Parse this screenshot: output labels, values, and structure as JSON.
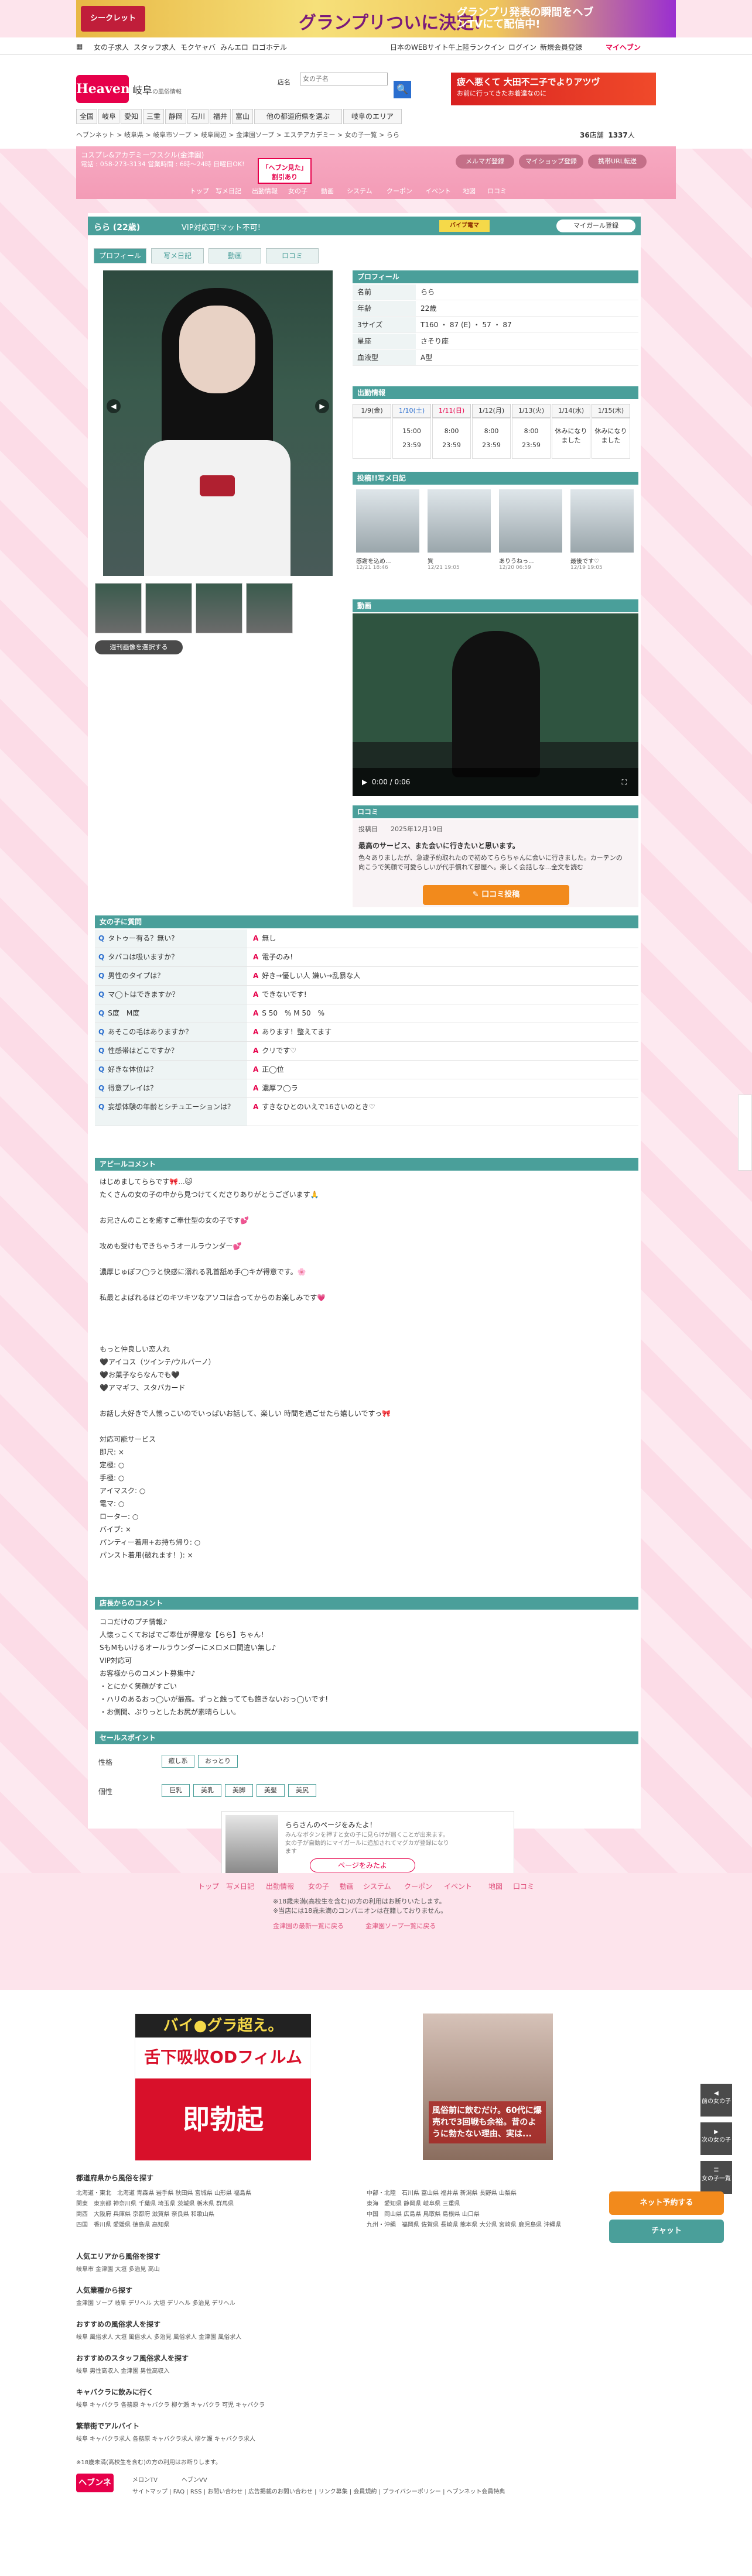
{
  "top_banner": {
    "logo": "シークレット",
    "headline": "グランプリついに決定!",
    "sub": "グランプリ発表の瞬間をヘブンTVにて配信中!"
  },
  "gnav": [
    "女の子求人",
    "スタッフ求人",
    "モクヤャバ",
    "みんエロ",
    "ロゴホテル"
  ],
  "gnav_right": [
    "日本のWEBサイト午上陸ランクイン",
    "ログイン",
    "新規会員登録",
    "マイヘブン"
  ],
  "logo": {
    "text": "Heaven",
    "area": "岐阜",
    "sub": "の風俗情報"
  },
  "search": {
    "label": "店名",
    "placeholder": "女の子名",
    "button": "🔍"
  },
  "header_banner": {
    "text": "疲へ悪くて 大田不二子でよりアツヴ",
    "sub": "お前に行ってきたお着達なのに"
  },
  "area_nav": [
    "全国",
    "岐阜",
    "愛知",
    "三重",
    "静岡",
    "石川",
    "福井",
    "富山",
    "他の都道府県を選ぶ",
    "岐阜のエリア"
  ],
  "breadcrumb": "ヘブンネット > 岐阜県 > 岐阜市ソープ > 岐阜周辺 > 金津園ソープ > エステアカデミー > 女の子一覧 > らら",
  "counts": {
    "shops": "36",
    "shops_unit": "店舗",
    "girls": "1337",
    "girls_unit": "人"
  },
  "shop": {
    "name": "コスプレ&アカデミーワスクル(金津園)",
    "tel": "電話 : 058-273-3134 営業時間 : 6時〜24時 日曜日OK!",
    "tag": "「ヘブン見た」",
    "tag2": "割引あり",
    "buttons": [
      "メルマガ登録",
      "マイショップ登録",
      "携帯URL転送"
    ]
  },
  "shop_nav": [
    "トップ",
    "写メ日記",
    "出勤情報",
    "女の子",
    "動画",
    "システム",
    "クーポン",
    "イベント",
    "地図",
    "ロコミ"
  ],
  "girl": {
    "name": "らら (22歳)",
    "vip": "VIP対応可!マット不可!",
    "icons_label": "バイブ電マ",
    "fav": "マイガール登録"
  },
  "tabs": [
    "プロフィール",
    "写メ日記",
    "動画",
    "ロコミ"
  ],
  "detail_button": "週刊画像を選択する",
  "profile": {
    "title": "プロフィール",
    "rows": [
      {
        "k": "名前",
        "v": "らら"
      },
      {
        "k": "年齢",
        "v": "22歳"
      },
      {
        "k": "3サイズ",
        "v": "T160 ・ 87 (E) ・ 57 ・ 87"
      },
      {
        "k": "星座",
        "v": "さそり座"
      },
      {
        "k": "血液型",
        "v": "A型"
      }
    ]
  },
  "schedule": {
    "title": "出勤情報",
    "days": [
      {
        "d": "1/9(金)",
        "t": ""
      },
      {
        "d": "1/10(土)",
        "t": "15:00\n23:59"
      },
      {
        "d": "1/11(日)",
        "t": "8:00\n23:59"
      },
      {
        "d": "1/12(月)",
        "t": "8:00\n23:59"
      },
      {
        "d": "1/13(火)",
        "t": "8:00\n23:59"
      },
      {
        "d": "1/14(水)",
        "t": "休みになりました"
      },
      {
        "d": "1/15(木)",
        "t": "休みになりました"
      }
    ]
  },
  "diary": {
    "title": "投稿!!写メ日記",
    "items": [
      {
        "t": "感謝を込め...",
        "d": "12/21 18:46"
      },
      {
        "t": "質",
        "d": "12/21 19:05"
      },
      {
        "t": "ありうねっ...",
        "d": "12/20 06:59"
      },
      {
        "t": "最後です♡",
        "d": "12/19 19:05"
      }
    ]
  },
  "video": {
    "title": "動画",
    "time": "0:00 / 0:06"
  },
  "review": {
    "title": "ロコミ",
    "date": "投稿日　　2025年12月19日",
    "headline": "最高のサービス、また会いに行きたいと思います。",
    "body": "色々ありましたが、急遽予約取れたので初めてららちゃんに会いに行きました。カーテンの向こうで笑顔で可愛らしいが代手慣れて部屋へ。楽しく会話しな...全文を読む",
    "button": "✎ 口コミ投稿"
  },
  "qa": {
    "title": "女の子に質問",
    "rows": [
      {
        "q": "タトゥー有る？無い?",
        "a": "無し"
      },
      {
        "q": "タバコは吸いますか？",
        "a": "電子のみ!"
      },
      {
        "q": "男性のタイプは？",
        "a": "好き→優しい人 嫌い→乱暴な人"
      },
      {
        "q": "マ◯トはできますか？",
        "a": "できないです!"
      },
      {
        "q": "S度　M度",
        "a": "S 50　% M 50　%"
      },
      {
        "q": "あそこの毛はありますか？",
        "a": "あります！整えてます"
      },
      {
        "q": "性感帯はどこですか？",
        "a": "クリです♡"
      },
      {
        "q": "好きな体位は？",
        "a": "正◯位"
      },
      {
        "q": "得意プレイは？",
        "a": "濃厚フ◯ラ"
      },
      {
        "q": "妄想体験の年齢とシチュエーションは？",
        "a": "すきなひとのいえで16さいのとき♡"
      }
    ]
  },
  "appeal": {
    "title": "アピールコメント",
    "lines": [
      "はじめましてららです🎀...🐱",
      "たくさんの女の子の中から見つけてくださりありがとうございます🙏",
      "",
      "お兄さんのことを癒すご奉仕型の女の子です💕",
      "",
      "攻めも受けもできちゃうオールラウンダー💕",
      "",
      "濃厚じゅぽフ◯ラと快感に溺れる乳首舐め手◯キが得意です。🌸",
      "",
      "私最とよばれるほどのキツキツなアソコは合ってからのお楽しみです💗",
      "",
      "",
      "",
      "もっと仲良しい恋人れ",
      "🖤アイコス（ツインテ/ウルバーノ）",
      "🖤お菓子ならなんでも🖤",
      "🖤アマギフ、スタバカード",
      "",
      "お話し大好きで人懐っこいのでいっぱいお話して、楽しい 時間を過ごせたら嬉しいですっ🎀",
      "",
      "対応可能サービス",
      "即尺: ×",
      "定極: ○",
      "手極: ○",
      "アイマスク: ○",
      "電マ: ○",
      "ローター: ○",
      "バイブ: ×",
      "パンティー着用+お持ち帰り: ○",
      "パンスト着用(破れます！): ×"
    ]
  },
  "shop_comment": {
    "title": "店長からのコメント",
    "lines": [
      "ココだけのプチ情報♪",
      "人懐っこくておばでご奉仕が得意な【らら】ちゃん！",
      "SもMもいけるオールラウンダーにメロメロ間違い無し♪",
      "VIP対応可",
      "お客様からのコメント募集中♪",
      "・とにかく笑顔がすごい",
      "・ハリのあるおっ◯いが最高。ずっと触ってても飽きないおっ◯いです!",
      "・お側聞、ぷりっとしたお尻が素晴らしい。"
    ]
  },
  "sales": {
    "title": "セールスポイント",
    "personality_label": "性格",
    "personality": [
      "癒し系",
      "おっとり"
    ],
    "looks_label": "個性",
    "looks": [
      "巨乳",
      "美乳",
      "美脚",
      "美髪",
      "美尻"
    ]
  },
  "promo": {
    "title": "ららさんのページをみたよ！",
    "sub": "みんなボタンを押すと女の子に見らけが届くことが出来ます。女の子が自動的にマイガールに追加されてマグカが登録になります",
    "button": "ページをみたよ"
  },
  "footer_nav": [
    "トップ",
    "写メ日記",
    "出勤情報",
    "女の子",
    "動画",
    "システム",
    "クーポン",
    "イベント",
    "地図",
    "口コミ"
  ],
  "footer_notes": [
    "※18歳未満(高校生を含む)の方の利用はお断りいたします。",
    "※当店には18歳未満のコンパニオンは在籍しておりません。"
  ],
  "footer_links": [
    "金津園の最新一覧に戻る",
    "金津園ソープ一覧に戻る"
  ],
  "ad1": {
    "t1": "バイ●グラ超え。",
    "t2": "舌下吸収ODフィルム",
    "t3": "即勃起"
  },
  "ad2": {
    "t": "風俗前に飲むだけ。60代に爆売れで3回戦も余裕。昔のように勃たない理由、実は..."
  },
  "footer_sections": [
    {
      "title": "都道府県から風俗を探す",
      "rows": [
        "北海道・東北　北海道 青森県 岩手県 秋田県 宮城県 山形県 福島県",
        "関東　東京都 神奈川県 千葉県 埼玉県 茨城県 栃木県 群馬県",
        "関西　大阪府 兵庫県 京都府 滋賀県 奈良県 和歌山県",
        "四国　香川県 愛媛県 徳島県 高知県"
      ]
    },
    {
      "title": "人気エリアから風俗を探す",
      "rows": [
        "岐阜市 金津園 大垣 多治見 高山"
      ]
    },
    {
      "title": "人気業種から探す",
      "rows": [
        "金津園 ソープ 岐阜 デリヘル 大垣 デリヘル 多治見 デリヘル"
      ]
    },
    {
      "title": "おすすめの風俗求人を探す",
      "rows": [
        "岐阜 風俗求人 大垣 風俗求人 多治見 風俗求人 金津園 風俗求人"
      ]
    },
    {
      "title": "おすすめのスタッフ風俗求人を探す",
      "rows": [
        "岐阜 男性高収入 金津園 男性高収入"
      ]
    },
    {
      "title": "キャバクラに飲みに行く",
      "rows": [
        "岐阜 キャバクラ 各務原 キャバクラ 柳ケ瀬 キャバクラ 可児 キャバクラ"
      ]
    },
    {
      "title": "繁華街でアルバイト",
      "rows": [
        "岐阜 キャバクラ求人 各務原 キャバクラ求人 柳ケ瀬 キャバクラ求人"
      ]
    }
  ],
  "footer_right_rows": [
    "中部・北陸　石川県 富山県 福井県 新潟県 長野県 山梨県",
    "東海　愛知県 静岡県 岐阜県 三重県",
    "中国　岡山県 広島県 鳥取県 島根県 山口県",
    "九州・沖縄　福岡県 佐賀県 長崎県 熊本県 大分県 宮崎県 鹿児島県 沖縄県"
  ],
  "footer_bottom": {
    "links": "サイトマップ | FAQ | RSS | お問い合わせ | 広告掲載のお問い合わせ | リンク募集 | 会員規約 | プライバシーポリシー | ヘブンネット会員特典",
    "note": "※18歳未満(高校生を含む)の方の利用はお断りします。",
    "copyright": "ヘブンネット",
    "tv": "メロンTV",
    "tv2": "ヘブンVV"
  },
  "side_buttons": [
    "前の女の子",
    "次の女の子",
    "女の子一覧"
  ],
  "sticky": {
    "net": "ネット予約する",
    "chat": "チャット"
  }
}
